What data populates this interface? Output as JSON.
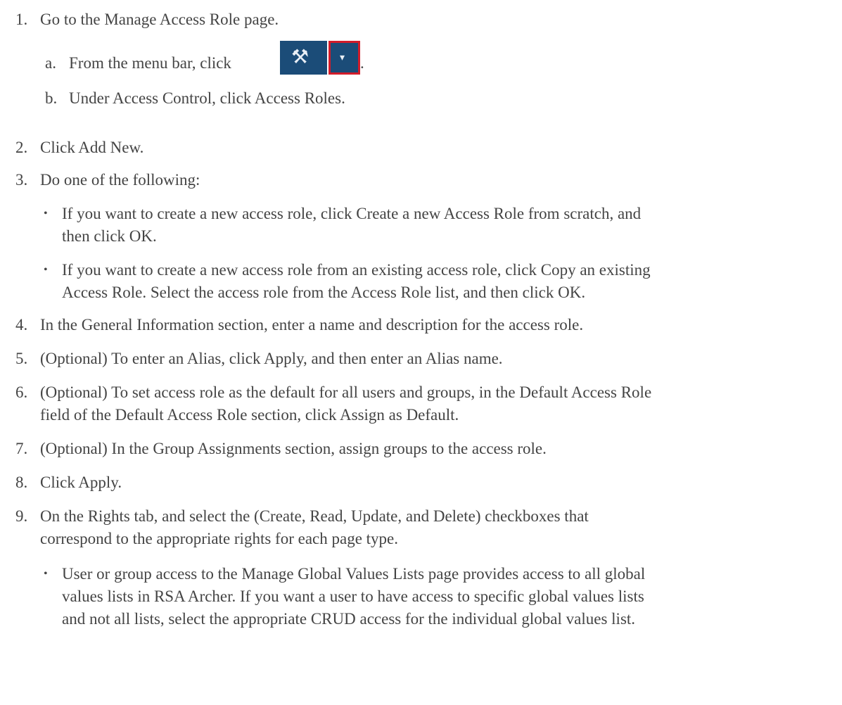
{
  "steps": [
    {
      "num": "1.",
      "text": "Go to the Manage Access Role page."
    },
    {
      "num": "2.",
      "text": "Click Add New."
    },
    {
      "num": "3.",
      "text": "Do one of the following:"
    },
    {
      "num": "4.",
      "text": "In the General Information section, enter a name and description for the access role."
    },
    {
      "num": "5.",
      "text": "(Optional) To enter an Alias, click Apply, and then enter an Alias name."
    },
    {
      "num": "6.",
      "line1": "(Optional) To set access role as the default for all users and groups, in the Default Access Role",
      "line2": "field of the Default Access Role section, click Assign as Default."
    },
    {
      "num": "7.",
      "text": "(Optional) In the Group Assignments section, assign groups to the access role."
    },
    {
      "num": "8.",
      "text": "Click Apply."
    },
    {
      "num": "9.",
      "line1": "On the Rights tab, and select the (Create, Read, Update, and Delete) checkboxes that",
      "line2": "correspond to the appropriate rights for each page type."
    }
  ],
  "substeps": [
    {
      "num": "a.",
      "text": "From the menu bar, click",
      "suffix": "."
    },
    {
      "num": "b.",
      "text": "Under Access Control, click Access Roles."
    }
  ],
  "bullets_step3": [
    {
      "line1": "If you want to create a new access role, click Create a new Access Role from scratch, and",
      "line2": "then click OK."
    },
    {
      "line1": "If you want to create a new access role from an existing access role, click Copy an existing",
      "line2": "Access Role. Select the access role from the Access Role list, and then click OK."
    }
  ],
  "bullets_step9": [
    {
      "line1": "User or group access to the Manage Global Values Lists page provides access to all global",
      "line2": "values lists in RSA Archer. If you want a user to have access to specific global values lists",
      "line3": "and not all lists, select the appropriate CRUD access for the individual global values list."
    }
  ],
  "bullet_glyph": "•",
  "menu_button": {
    "tools_icon": "tools-icon",
    "dropdown_icon": "dropdown-arrow-icon",
    "tools_glyph": "⚒",
    "drop_glyph": "▾",
    "highlight_color": "#d21c2a",
    "button_color": "#1b4c78"
  }
}
